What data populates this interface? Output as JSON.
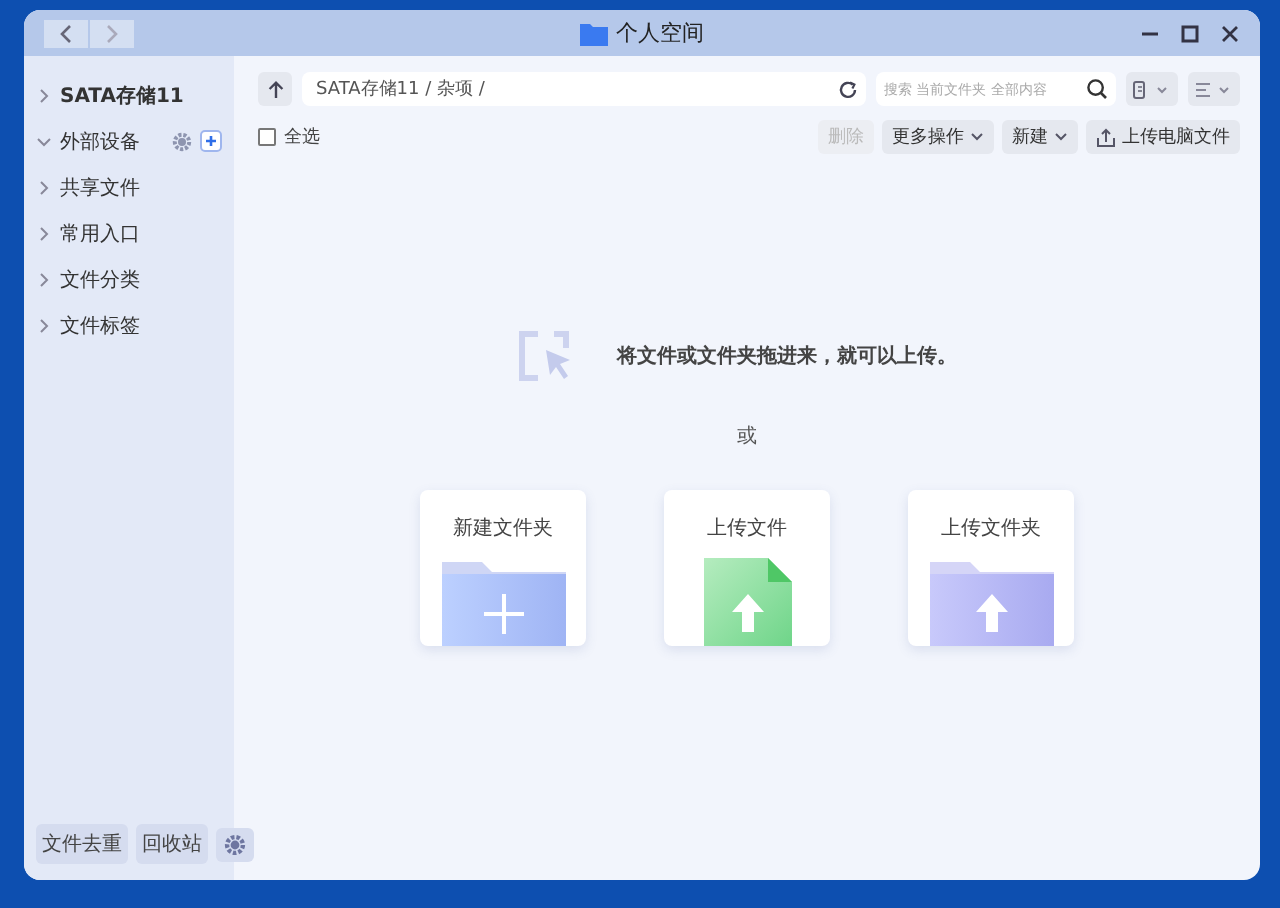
{
  "window": {
    "title": "个人空间"
  },
  "sidebar": {
    "items": [
      {
        "label": "SATA存储11",
        "expanded": false,
        "bold": true,
        "tools": false
      },
      {
        "label": "外部设备",
        "expanded": true,
        "bold": false,
        "tools": true
      },
      {
        "label": "共享文件",
        "expanded": false,
        "bold": false,
        "tools": false
      },
      {
        "label": "常用入口",
        "expanded": false,
        "bold": false,
        "tools": false
      },
      {
        "label": "文件分类",
        "expanded": false,
        "bold": false,
        "tools": false
      },
      {
        "label": "文件标签",
        "expanded": false,
        "bold": false,
        "tools": false
      }
    ],
    "footer_buttons": [
      "文件去重",
      "回收站"
    ]
  },
  "toolbar": {
    "path": "SATA存储11 / 杂项 /",
    "search": {
      "placeholder": "搜索 当前文件夹 全部内容"
    }
  },
  "actions": {
    "select_all": {
      "label": "全选",
      "checked": false
    },
    "buttons": [
      {
        "label": "删除",
        "disabled": true,
        "kind": "plain"
      },
      {
        "label": "更多操作",
        "disabled": false,
        "kind": "dropdown"
      },
      {
        "label": "新建",
        "disabled": false,
        "kind": "dropdown"
      },
      {
        "label": "上传电脑文件",
        "disabled": false,
        "kind": "upload"
      }
    ]
  },
  "drop_zone": {
    "message": "将文件或文件夹拖进来，就可以上传。",
    "or": "或",
    "cards": [
      {
        "label": "新建文件夹",
        "kind": "new-folder"
      },
      {
        "label": "上传文件",
        "kind": "upload-file"
      },
      {
        "label": "上传文件夹",
        "kind": "upload-folder"
      }
    ]
  }
}
